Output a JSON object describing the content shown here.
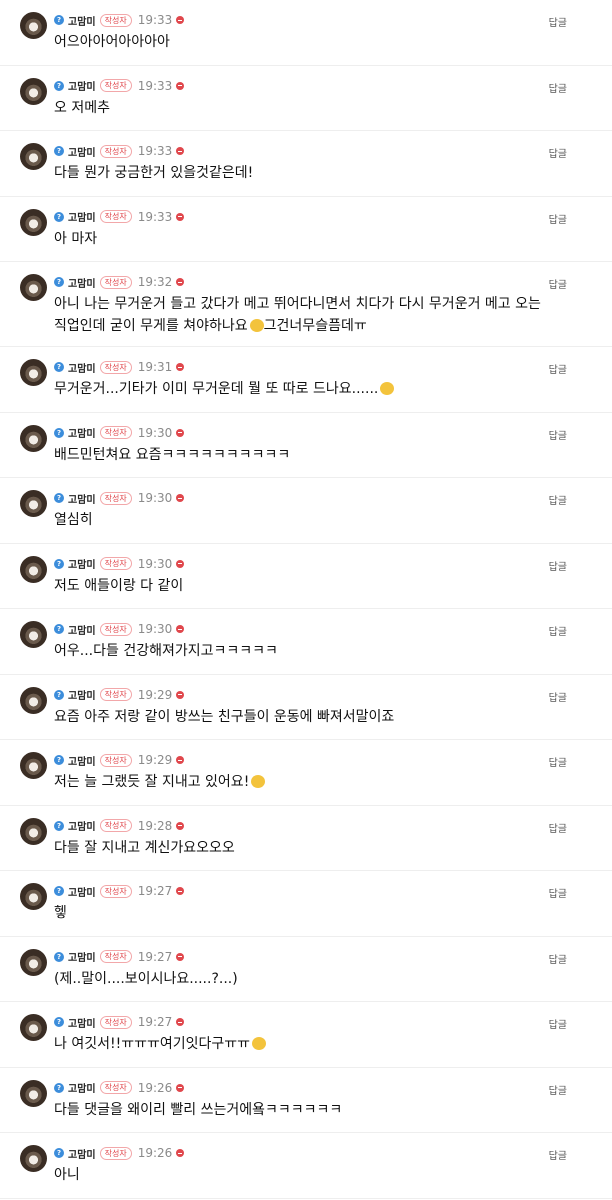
{
  "common": {
    "nickname": "고맘미",
    "author_badge": "작성자",
    "reply_label": "답글",
    "level_badge": "?"
  },
  "comments": [
    {
      "time": "19:33",
      "text": "어으아아어아아아아"
    },
    {
      "time": "19:33",
      "text": "오 저메추"
    },
    {
      "time": "19:33",
      "text": "다들 뭔가 궁금한거 있을것같은데!"
    },
    {
      "time": "19:33",
      "text": "아 마자"
    },
    {
      "time": "19:32",
      "text": "아니 나는 무거운거 들고 갔다가 메고 뛰어다니면서 치다가 다시 무거운거 메고 오는\n직업인데 굳이 무게를 쳐야하나요",
      "text2": "그건너무슬픔데ㅠ"
    },
    {
      "time": "19:31",
      "text": "무거운거...기타가 이미 무거운데 뭘 또 따로 드나요......",
      "text2": ""
    },
    {
      "time": "19:30",
      "text": "배드민턴쳐요 요즘ㅋㅋㅋㅋㅋㅋㅋㅋㅋㅋ"
    },
    {
      "time": "19:30",
      "text": "열심히"
    },
    {
      "time": "19:30",
      "text": "저도 애들이랑 다 같이"
    },
    {
      "time": "19:30",
      "text": "어우...다들 건강해져가지고ㅋㅋㅋㅋㅋ"
    },
    {
      "time": "19:29",
      "text": "요즘 아주 저랑 같이 방쓰는 친구들이 운동에 빠져서말이죠"
    },
    {
      "time": "19:29",
      "text": "저는 늘 그랬듯 잘 지내고 있어요!",
      "text2": ""
    },
    {
      "time": "19:28",
      "text": "다들 잘 지내고 계신가요오오오"
    },
    {
      "time": "19:27",
      "text": "헿"
    },
    {
      "time": "19:27",
      "text": "(제..말이....보이시나요.....?...)"
    },
    {
      "time": "19:27",
      "text": "나 여깃서!!ㅠㅠㅠ여기잇다구ㅠㅠ",
      "text2": ""
    },
    {
      "time": "19:26",
      "text": "다들 댓글을 왜이리 빨리 쓰는거에욬ㅋㅋㅋㅋㅋㅋ"
    },
    {
      "time": "19:26",
      "text": "아니"
    }
  ],
  "colors": {
    "badge_red": "#e0474c",
    "level_blue": "#3c8ddb",
    "time_gray": "#8a8a8a",
    "emoji_yellow": "#f3c33c"
  }
}
